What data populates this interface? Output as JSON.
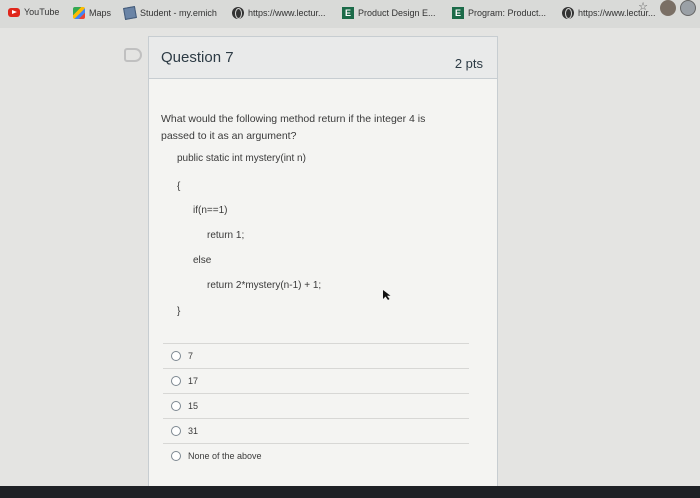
{
  "bookmarks": [
    {
      "icon": "youtube-icon",
      "label": "YouTube"
    },
    {
      "icon": "maps-icon",
      "label": "Maps"
    },
    {
      "icon": "student-icon",
      "label": "Student - my.emich"
    },
    {
      "icon": "globe-icon",
      "label": "https://www.lectur..."
    },
    {
      "icon": "e-icon",
      "label": "Product Design E..."
    },
    {
      "icon": "e-icon",
      "label": "Program: Product..."
    },
    {
      "icon": "globe-icon",
      "label": "https://www.lectur..."
    }
  ],
  "question": {
    "title": "Question 7",
    "points": "2 pts",
    "text": "What would the following method return if the integer 4 is passed to it as an argument?",
    "code": [
      "public static int mystery(int n)",
      "{",
      "if(n==1)",
      "return 1;",
      "else",
      "return 2*mystery(n-1) + 1;",
      "}"
    ],
    "answers": [
      "7",
      "17",
      "15",
      "31",
      "None of the above"
    ]
  },
  "colors": {
    "background": "#e4e4e2",
    "card": "#f4f4f2",
    "header": "#e9eaea",
    "bookmark_bar": "#d9dad8"
  }
}
